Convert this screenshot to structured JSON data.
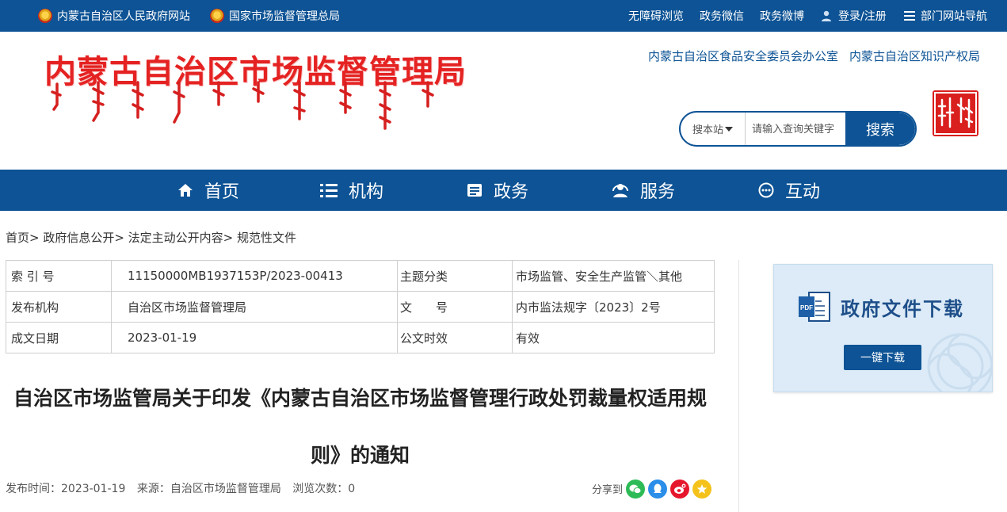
{
  "topbar": {
    "left_links": [
      "内蒙古自治区人民政府网站",
      "国家市场监督管理总局"
    ],
    "right_links": [
      "无障碍浏览",
      "政务微信",
      "政务微博"
    ],
    "login": "登录/注册",
    "nav": "部门网站导航"
  },
  "header": {
    "title": "内蒙古自治区市场监督管理局",
    "links": [
      "内蒙古自治区食品安全委员会办公室",
      "内蒙古自治区知识产权局"
    ],
    "search": {
      "scope": "搜本站",
      "placeholder": "请输入查询关键字",
      "button": "搜索"
    }
  },
  "nav": {
    "items": [
      {
        "label": "首页",
        "icon": "home-icon"
      },
      {
        "label": "机构",
        "icon": "list-icon"
      },
      {
        "label": "政务",
        "icon": "document-icon"
      },
      {
        "label": "服务",
        "icon": "service-icon"
      },
      {
        "label": "互动",
        "icon": "chat-icon"
      }
    ]
  },
  "breadcrumb": "首页> 政府信息公开> 法定主动公开内容> 规范性文件",
  "info": {
    "rows": [
      {
        "k1": "索 引 号",
        "v1": "11150000MB1937153P/2023-00413",
        "k2": "主题分类",
        "v2": "市场监管、安全生产监管＼其他"
      },
      {
        "k1": "发布机构",
        "v1": "自治区市场监督管理局",
        "k2": "文　　号",
        "v2": "内市监法规字〔2023〕2号"
      },
      {
        "k1": "成文日期",
        "v1": "2023-01-19",
        "k2": "公文时效",
        "v2": "有效"
      }
    ]
  },
  "doc": {
    "title_line1": "自治区市场监管局关于印发《内蒙古自治区市场监督管理行政处罚裁量权适用规",
    "title_line2": "则》的通知",
    "meta_date": "发布时间：2023-01-19",
    "meta_source": "来源：自治区市场监督管理局",
    "meta_views": "浏览次数：0",
    "share_label": "分享到"
  },
  "download": {
    "title": "政府文件下载",
    "button": "一键下载"
  },
  "colors": {
    "primary": "#0d5395",
    "title_red": "#e52222",
    "wechat": "#2dbb57",
    "qq": "#2b8ee8",
    "weibo": "#e6162d",
    "qzone": "#f4c21b"
  }
}
